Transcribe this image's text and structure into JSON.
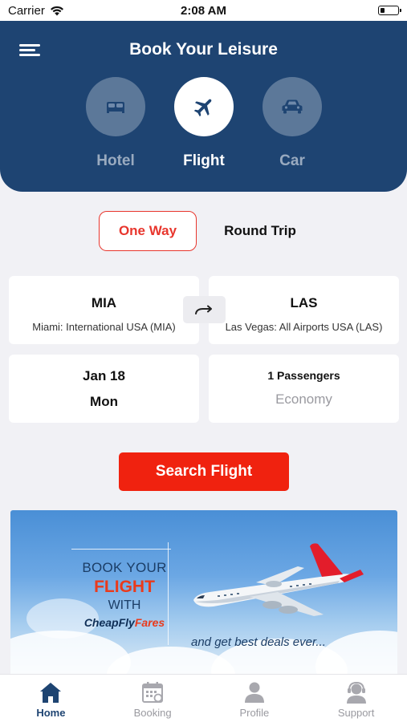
{
  "status_bar": {
    "carrier": "Carrier",
    "time": "2:08 AM"
  },
  "header": {
    "title": "Book Your Leisure"
  },
  "modes": [
    {
      "label": "Hotel",
      "icon": "bed-icon",
      "active": false
    },
    {
      "label": "Flight",
      "icon": "airplane-icon",
      "active": true
    },
    {
      "label": "Car",
      "icon": "car-icon",
      "active": false
    }
  ],
  "trip_type": {
    "one_way": "One Way",
    "round_trip": "Round Trip",
    "selected": "One Way"
  },
  "route": {
    "origin": {
      "code": "MIA",
      "name": "Miami: International USA (MIA)"
    },
    "destination": {
      "code": "LAS",
      "name": "Las Vegas: All Airports USA (LAS)"
    }
  },
  "date": {
    "day": "Jan 18",
    "weekday": "Mon"
  },
  "travellers": {
    "passengers": "1 Passengers",
    "cabin": "Economy"
  },
  "search": {
    "label": "Search Flight"
  },
  "banner": {
    "line1": "BOOK YOUR",
    "line2": "FLIGHT",
    "line3": "WITH",
    "brand_part1": "CheapFly",
    "brand_part2": "Fares",
    "tagline": "and get best deals ever..."
  },
  "bottom_nav": [
    {
      "label": "Home",
      "icon": "home-icon",
      "active": true
    },
    {
      "label": "Booking",
      "icon": "calendar-icon",
      "active": false
    },
    {
      "label": "Profile",
      "icon": "person-icon",
      "active": false
    },
    {
      "label": "Support",
      "icon": "headset-icon",
      "active": false
    }
  ],
  "colors": {
    "header": "#1e4472",
    "accent_red": "#f0220f",
    "background": "#f1f1f5"
  }
}
